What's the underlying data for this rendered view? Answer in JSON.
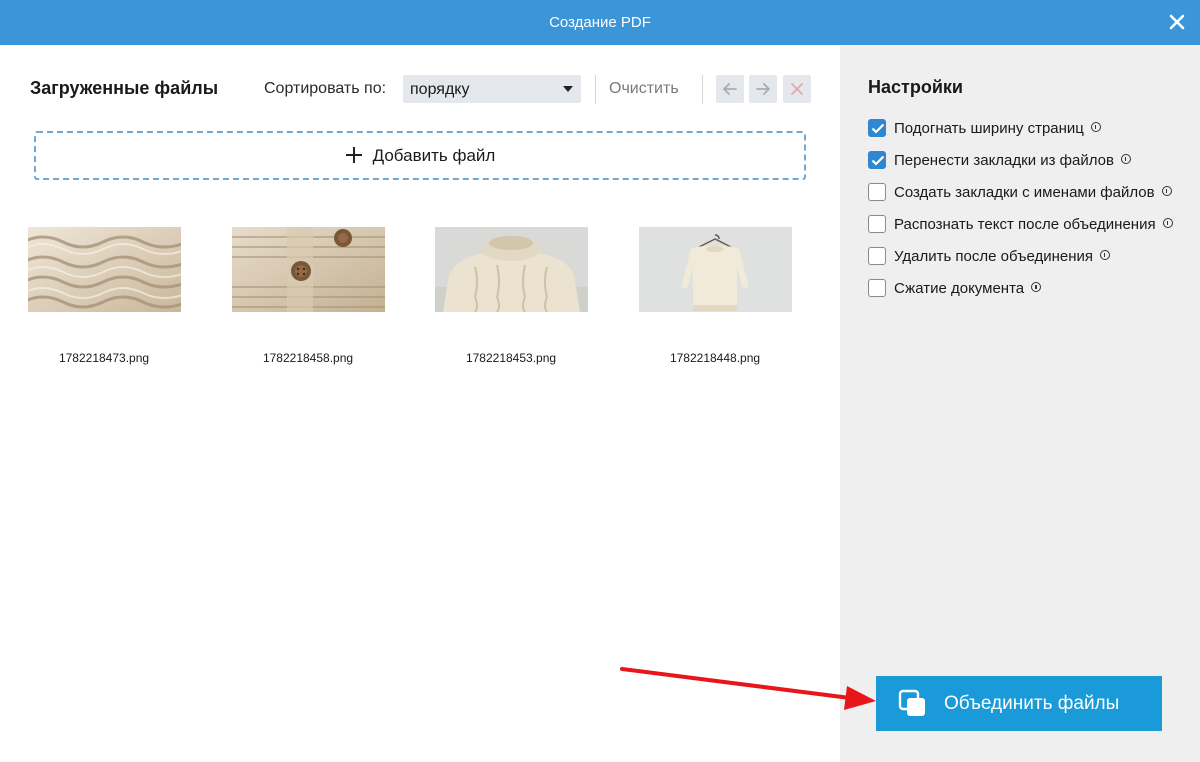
{
  "window": {
    "title": "Создание PDF",
    "close_icon": "close-icon"
  },
  "main": {
    "heading": "Загруженные файлы",
    "sort": {
      "label": "Сортировать по:",
      "value": "порядку"
    },
    "clear_label": "Очистить",
    "toolbar_icons": [
      "arrow-left-icon",
      "arrow-right-icon",
      "delete-icon"
    ],
    "add_file_label": "Добавить файл",
    "files": [
      {
        "name": "1782218473.png",
        "preview": "cable-knit close-up"
      },
      {
        "name": "1782218458.png",
        "preview": "cardigan with buttons"
      },
      {
        "name": "1782218453.png",
        "preview": "turtleneck sweater"
      },
      {
        "name": "1782218448.png",
        "preview": "sweater on hanger"
      }
    ]
  },
  "settings": {
    "title": "Настройки",
    "options": [
      {
        "label": "Подогнать ширину страниц",
        "checked": true
      },
      {
        "label": "Перенести закладки из файлов",
        "checked": true
      },
      {
        "label": "Создать закладки с именами файлов",
        "checked": false
      },
      {
        "label": "Распознать текст после объединения",
        "checked": false
      },
      {
        "label": "Удалить после объединения",
        "checked": false
      },
      {
        "label": "Сжатие документа",
        "checked": false
      }
    ],
    "merge_button_label": "Объединить файлы"
  },
  "colors": {
    "titlebar": "#3b95d9",
    "accent": "#1a9ad9",
    "checkbox": "#2f87d0",
    "annotation_arrow": "#e8151b"
  }
}
